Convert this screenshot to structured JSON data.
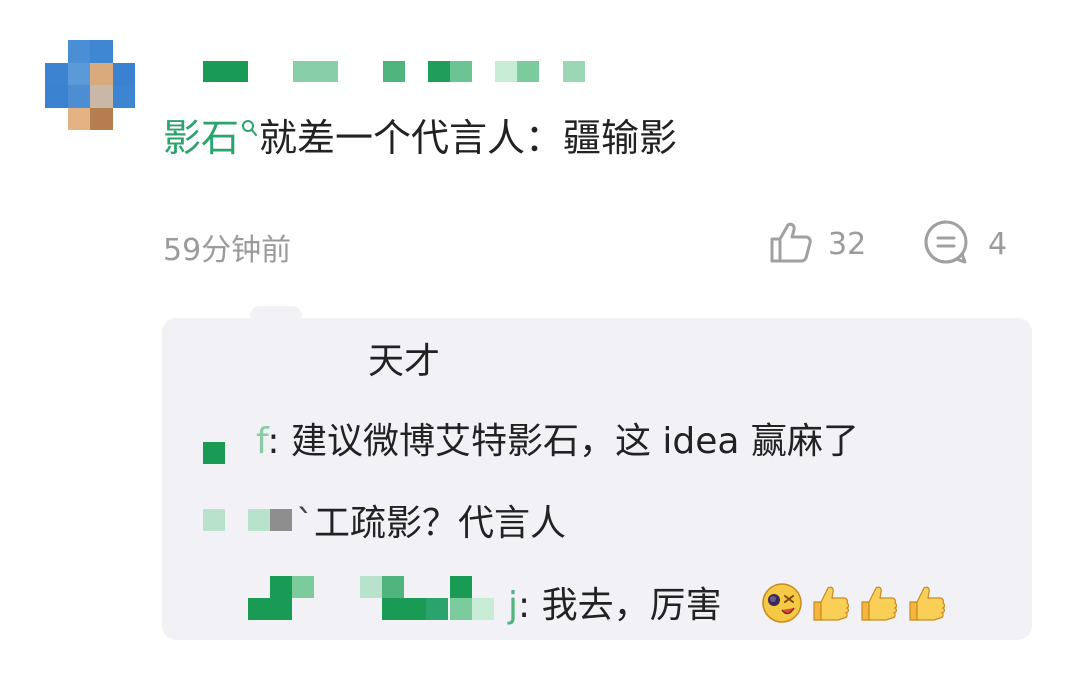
{
  "comment": {
    "topic": "影石",
    "text": "就差一个代言人：疆输影",
    "timestamp": "59分钟前",
    "like_count": "32",
    "reply_count": "4"
  },
  "replies": [
    {
      "text": "天才"
    },
    {
      "username_fragment": "f",
      "text": ": 建议微博艾特影石，这 idea 赢麻了"
    },
    {
      "username_fragment": "`",
      "text": "工疏影？代言人"
    },
    {
      "username_fragment": "j",
      "text": ": 我去，厉害"
    }
  ],
  "icons": {
    "topic": "search-icon",
    "like": "thumbs-up-icon",
    "reply": "comment-icon",
    "emoji_1": "dizzy-face-emoji",
    "emoji_2": "thumbs-up-emoji"
  },
  "colors": {
    "topic_green": "#2aa36d",
    "mosaic_green": "#1a9b55",
    "meta_gray": "#9b9b9b",
    "reply_bg": "#f2f2f6"
  }
}
